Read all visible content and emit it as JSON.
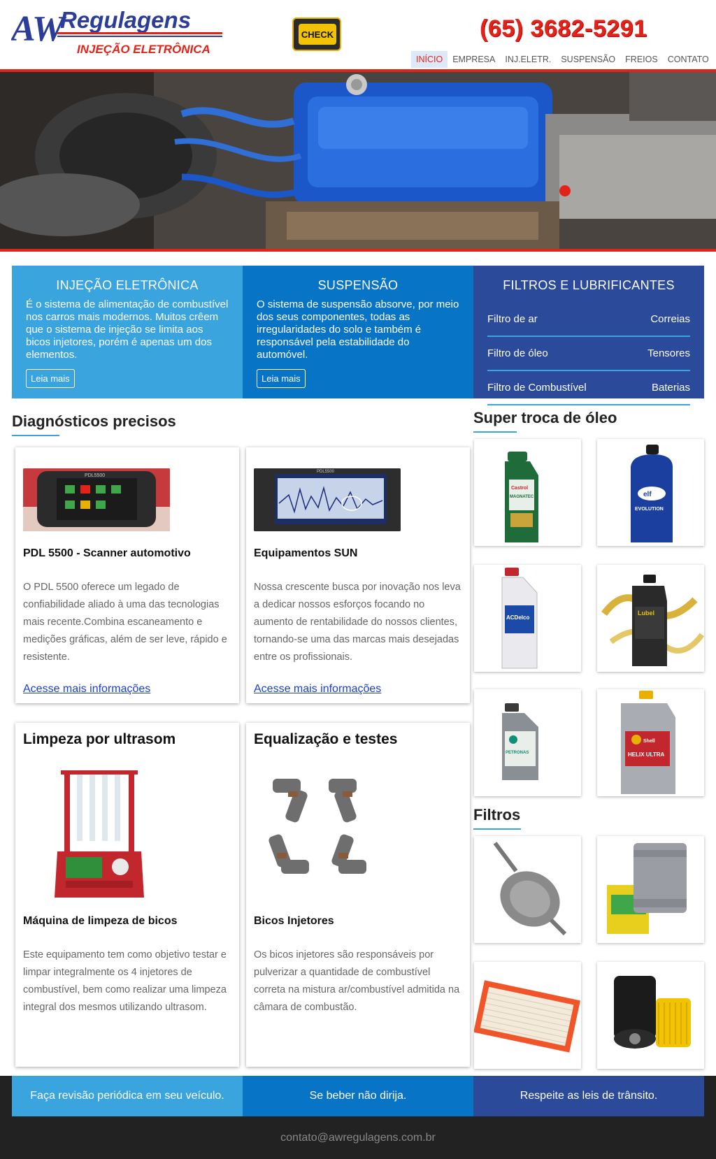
{
  "header": {
    "logo_aw": "AW",
    "logo_name": "Regulagens",
    "logo_tagline": "INJEÇÃO ELETRÔNICA",
    "check_label": "CHECK",
    "phone": "(65) 3682-5291"
  },
  "nav": [
    {
      "label": "INÍCIO",
      "active": true
    },
    {
      "label": "EMPRESA",
      "active": false
    },
    {
      "label": "INJ.ELETR.",
      "active": false
    },
    {
      "label": "SUSPENSÃO",
      "active": false
    },
    {
      "label": "FREIOS",
      "active": false
    },
    {
      "label": "CONTATO",
      "active": false
    }
  ],
  "features": {
    "injecao": {
      "title": "INJEÇÃO ELETRÔNICA",
      "text": "É o sistema de alimentação de combustível nos carros mais modernos. Muitos crêem que o sistema de injeção se limita aos bicos injetores, porém é apenas um dos elementos.",
      "button": "Leia mais"
    },
    "suspensao": {
      "title": "SUSPENSÃO",
      "text": "O sistema de suspensão absorve, por meio dos seus componentes, todas as irregularidades do solo e também é responsável pela estabilidade do automóvel.",
      "button": "Leia mais"
    },
    "filtros": {
      "title": "FILTROS E LUBRIFICANTES",
      "rows": [
        {
          "left": "Filtro de ar",
          "right": "Correias"
        },
        {
          "left": "Filtro de óleo",
          "right": "Tensores"
        },
        {
          "left": "Filtro de Combustível",
          "right": "Baterias"
        }
      ]
    }
  },
  "diagnosticos": {
    "title": "Diagnósticos precisos",
    "cards": [
      {
        "title": "PDL 5500 - Scanner automotivo",
        "text": "O PDL 5500 oferece um legado de confiabilidade aliado à uma das tecnologias mais recente.Combina escaneamento e medições gráficas, além de ser leve, rápido e resistente.",
        "link": "Acesse mais informações",
        "device_label": "PDL5500"
      },
      {
        "title": "Equipamentos SUN",
        "text": "Nossa crescente busca por inovação nos leva a dedicar nossos esforços focando no aumento de rentabilidade do nossos clientes, tornando-se uma das marcas mais desejadas entre os profissionais.",
        "link": "Acesse mais informações",
        "device_label": "PDL5500"
      }
    ]
  },
  "servicos": [
    {
      "heading": "Limpeza por ultrasom",
      "title": "Máquina de limpeza de bicos",
      "text": "Este equipamento tem como objetivo testar e limpar integralmente os 4 injetores de combustível, bem como realizar uma limpeza integral dos mesmos utilizando ultrasom."
    },
    {
      "heading": "Equalização e testes",
      "title": "Bicos Injetores",
      "text": "Os bicos injetores são responsáveis por pulverizar a quantidade de combustível correta na mistura ar/combustível admitida na câmara de combustão."
    }
  ],
  "oleo": {
    "title": "Super troca de óleo",
    "products": [
      {
        "brand": "Castrol",
        "line": "MAGNATEC",
        "color": "#1f6b3a"
      },
      {
        "brand": "elf",
        "line": "EVOLUTION",
        "color": "#1b3f9e"
      },
      {
        "brand": "ACDelco",
        "line": "",
        "color": "#e9e9ee"
      },
      {
        "brand": "Lubel",
        "line": "",
        "color": "#2a2a2a"
      },
      {
        "brand": "PETRONAS",
        "line": "",
        "color": "#8a8f96"
      },
      {
        "brand": "Shell",
        "line": "HELIX ULTRA",
        "color": "#a9adb3"
      }
    ]
  },
  "filtros": {
    "title": "Filtros"
  },
  "slogans": [
    "Faça revisão periódica em seu veículo.",
    "Se beber não dirija.",
    "Respeite as leis de trânsito."
  ],
  "footer": {
    "email": "contato@awregulagens.com.br"
  },
  "colors": {
    "red": "#e2231a",
    "light_blue": "#3aa4df",
    "mid_blue": "#0874c6",
    "dark_blue": "#2b4a9a"
  }
}
